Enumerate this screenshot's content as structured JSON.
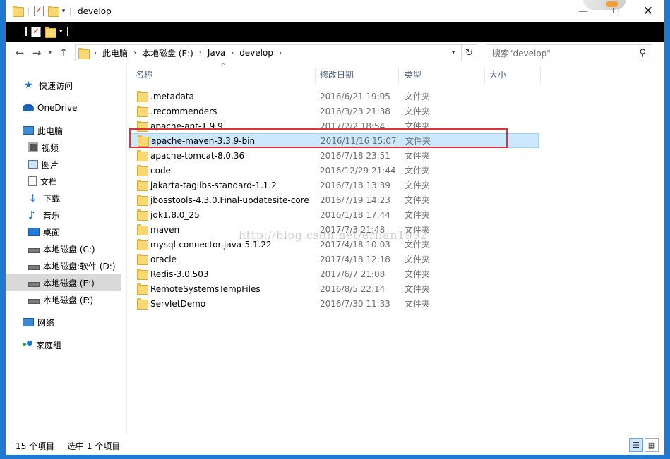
{
  "window": {
    "title": "develop",
    "controls": {
      "minimize": "—",
      "maximize": "☐",
      "close": "✕"
    }
  },
  "address_bar": {
    "crumbs": [
      "此电脑",
      "本地磁盘 (E:)",
      "Java",
      "develop"
    ]
  },
  "search": {
    "placeholder": "搜索\"develop\""
  },
  "sidebar": {
    "items": [
      {
        "label": "快速访问",
        "icon": "star-icon"
      },
      {
        "label": "OneDrive",
        "icon": "cloud-icon"
      },
      {
        "label": "此电脑",
        "icon": "computer-icon"
      },
      {
        "label": "视频",
        "icon": "video-icon"
      },
      {
        "label": "图片",
        "icon": "picture-icon"
      },
      {
        "label": "文档",
        "icon": "document-icon"
      },
      {
        "label": "下载",
        "icon": "download-icon"
      },
      {
        "label": "音乐",
        "icon": "music-icon"
      },
      {
        "label": "桌面",
        "icon": "desktop-icon"
      },
      {
        "label": "本地磁盘 (C:)",
        "icon": "drive-icon"
      },
      {
        "label": "本地磁盘:软件 (D:)",
        "icon": "drive-icon"
      },
      {
        "label": "本地磁盘 (E:)",
        "icon": "drive-icon",
        "selected": true
      },
      {
        "label": "本地磁盘 (F:)",
        "icon": "drive-icon"
      },
      {
        "label": "网络",
        "icon": "network-icon"
      },
      {
        "label": "家庭组",
        "icon": "homegroup-icon"
      }
    ]
  },
  "columns": {
    "name": "名称",
    "date": "修改日期",
    "type": "类型",
    "size": "大小"
  },
  "files": [
    {
      "name": ".metadata",
      "date": "2016/6/21 19:05",
      "type": "文件夹"
    },
    {
      "name": ".recommenders",
      "date": "2016/3/23 21:38",
      "type": "文件夹"
    },
    {
      "name": "apache-ant-1.9.9",
      "date": "2017/2/2 18:54",
      "type": "文件夹"
    },
    {
      "name": "apache-maven-3.3.9-bin",
      "date": "2016/11/16 15:07",
      "type": "文件夹",
      "selected": true
    },
    {
      "name": "apache-tomcat-8.0.36",
      "date": "2016/7/18 23:51",
      "type": "文件夹"
    },
    {
      "name": "code",
      "date": "2016/12/29 21:44",
      "type": "文件夹"
    },
    {
      "name": "jakarta-taglibs-standard-1.1.2",
      "date": "2016/7/18 13:39",
      "type": "文件夹"
    },
    {
      "name": "jbosstools-4.3.0.Final-updatesite-core",
      "date": "2016/7/19 14:23",
      "type": "文件夹"
    },
    {
      "name": "jdk1.8.0_25",
      "date": "2016/1/18 17:44",
      "type": "文件夹"
    },
    {
      "name": "maven",
      "date": "2017/7/3 21:48",
      "type": "文件夹"
    },
    {
      "name": "mysql-connector-java-5.1.22",
      "date": "2017/4/18 10:03",
      "type": "文件夹"
    },
    {
      "name": "oracle",
      "date": "2017/4/18 12:18",
      "type": "文件夹"
    },
    {
      "name": "Redis-3.0.503",
      "date": "2017/6/7 21:08",
      "type": "文件夹"
    },
    {
      "name": "RemoteSystemsTempFiles",
      "date": "2016/8/5 22:14",
      "type": "文件夹"
    },
    {
      "name": "ServletDemo",
      "date": "2016/7/30 11:33",
      "type": "文件夹"
    }
  ],
  "watermark": "http://blog.csdn.net/erlian1992",
  "status": {
    "count": "15 个项目",
    "selection": "选中 1 个项目"
  },
  "colors": {
    "accent": "#1e7ad0",
    "selection_bg": "#cce8ff",
    "highlight_border": "#e0303a"
  }
}
